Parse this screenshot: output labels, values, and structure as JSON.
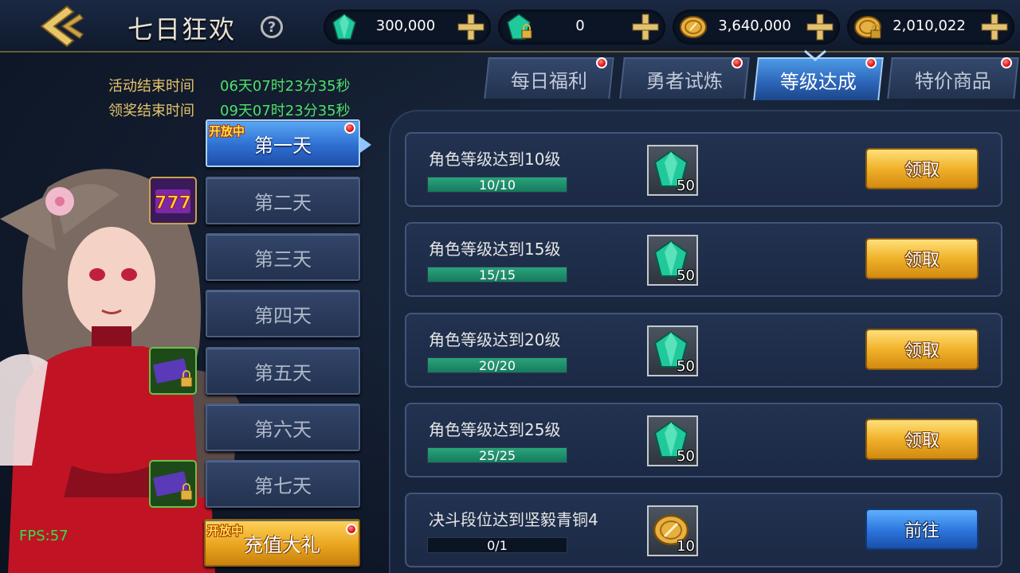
{
  "header": {
    "title": "七日狂欢",
    "currencies": [
      {
        "icon": "green-diamond-icon",
        "value": "300,000"
      },
      {
        "icon": "locked-green-diamond-icon",
        "value": "0"
      },
      {
        "icon": "gold-coin-icon",
        "value": "3,640,000"
      },
      {
        "icon": "locked-gold-coin-icon",
        "value": "2,010,022"
      }
    ]
  },
  "timers": {
    "event_end_label": "活动结束时间",
    "event_end_value": "06天07时23分35秒",
    "claim_end_label": "领奖结束时间",
    "claim_end_value": "09天07时23分35秒"
  },
  "days": [
    {
      "label": "第一天",
      "tag": "开放中",
      "active": true
    },
    {
      "label": "第二天"
    },
    {
      "label": "第三天"
    },
    {
      "label": "第四天"
    },
    {
      "label": "第五天"
    },
    {
      "label": "第六天"
    },
    {
      "label": "第七天"
    }
  ],
  "gift": {
    "label": "充值大礼",
    "tag": "开放中"
  },
  "tabs": [
    {
      "label": "每日福利"
    },
    {
      "label": "勇者试炼"
    },
    {
      "label": "等级达成",
      "active": true
    },
    {
      "label": "特价商品"
    }
  ],
  "tasks": [
    {
      "title": "角色等级达到10级",
      "progress": "10/10",
      "progress_ratio": 1.0,
      "reward_icon": "green-diamond-icon",
      "reward_qty": "50",
      "action": "领取",
      "action_type": "claim"
    },
    {
      "title": "角色等级达到15级",
      "progress": "15/15",
      "progress_ratio": 1.0,
      "reward_icon": "green-diamond-icon",
      "reward_qty": "50",
      "action": "领取",
      "action_type": "claim"
    },
    {
      "title": "角色等级达到20级",
      "progress": "20/20",
      "progress_ratio": 1.0,
      "reward_icon": "green-diamond-icon",
      "reward_qty": "50",
      "action": "领取",
      "action_type": "claim"
    },
    {
      "title": "角色等级达到25级",
      "progress": "25/25",
      "progress_ratio": 1.0,
      "reward_icon": "green-diamond-icon",
      "reward_qty": "50",
      "action": "领取",
      "action_type": "claim"
    },
    {
      "title": "决斗段位达到坚毅青铜4",
      "progress": "0/1",
      "progress_ratio": 0.0,
      "reward_icon": "gold-coin-icon",
      "reward_qty": "10",
      "action": "前往",
      "action_type": "goto"
    }
  ],
  "fps": "FPS:57",
  "colors": {
    "accent_gold": "#f0b12a",
    "active_blue": "#2e6fd1",
    "timer_green": "#4fe06a",
    "label_gold": "#e6c36a"
  }
}
